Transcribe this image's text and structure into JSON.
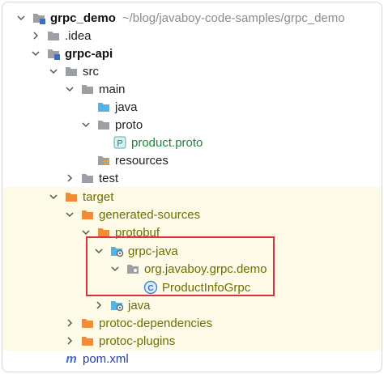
{
  "tree": {
    "root": {
      "name": "grpc_demo",
      "path": "~/blog/javaboy-code-samples/grpc_demo"
    },
    "items": [
      {
        "label": ".idea"
      },
      {
        "label": "grpc-api"
      },
      {
        "label": "src"
      },
      {
        "label": "main"
      },
      {
        "label": "java"
      },
      {
        "label": "proto"
      },
      {
        "label": "product.proto",
        "icon_letter": "P"
      },
      {
        "label": "resources"
      },
      {
        "label": "test"
      },
      {
        "label": "target"
      },
      {
        "label": "generated-sources"
      },
      {
        "label": "protobuf"
      },
      {
        "label": "grpc-java"
      },
      {
        "label": "org.javaboy.grpc.demo"
      },
      {
        "label": "ProductInfoGrpc",
        "icon_letter": "C"
      },
      {
        "label": "java"
      },
      {
        "label": "protoc-dependencies"
      },
      {
        "label": "protoc-plugins"
      },
      {
        "label": "pom.xml",
        "icon_letter": "m"
      }
    ]
  },
  "colors": {
    "folder_gray": "#9aa0a6",
    "folder_orange": "#f28c37",
    "folder_blue": "#55b3e8",
    "excluded_bg": "#fdfbe7",
    "highlight_border": "#e0303a",
    "text_olive": "#6e6e00",
    "text_green": "#23803a",
    "text_blue": "#1f3fa5"
  }
}
